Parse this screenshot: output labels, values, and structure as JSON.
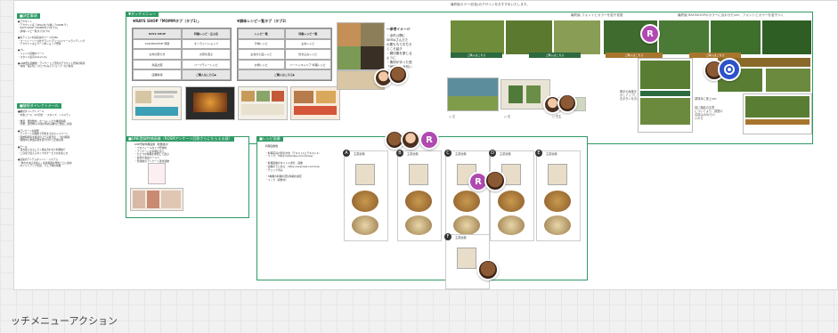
{
  "bottom_label": "ッチメニューアクション",
  "top_note": "最終版カラー(紅色)のデザインをおすすめいたします。",
  "section_tags": {
    "left_top": "■決定事項",
    "touch_menu": "▼タッチメニュー",
    "left_mid": "■継続ダイレクトメール",
    "line_section": "■LINE登録特典画像（ROSMアンケート回答さらにもらえる部）",
    "recipe_section": "■レシピ画像"
  },
  "tab_labels": {
    "shop_tab": "▼RAYS SHOP「MOMMタブ（タブ1）」",
    "recipe_tab": "▼調味レシピ一覧タブ（タブ2）"
  },
  "table_left": {
    "cells": [
      "RAYS SHOP",
      "特集レシピ・豆ぶ名",
      "SAKURASHOP 特選",
      "オンラインショップ",
      "お米の贈り方",
      "お茶を選ぶ",
      "商品比較",
      "ハーブティーレシピ",
      "店舗情報",
      "ご購入はこちら▶"
    ]
  },
  "table_right": {
    "cells": [
      "レシピ一覧",
      "特集レシピ一覧",
      "汁物レシピ",
      "主食レシピ",
      "主食の小皿レシピ",
      "炊き込みレシピ",
      "お鍋レシピ",
      "ハーハッキャリア 料理レシピ",
      "ご購入はこちら▶"
    ]
  },
  "callout": {
    "title": "～参考イメージ",
    "lines": [
      "・全件公開に",
      "SEMAさんだた",
      "の要ももでおちろ",
      "ところ紹介",
      "・親切素を繁じる",
      "ように",
      "・素材が手った型",
      "「地球」と合句い",
      "ドアの鮮の_」"
    ]
  },
  "rich_menu_titles": [
    "最終版 フォントとカラーを若干変更",
    "最終版 RAYSSHOPのカラーに合わせたver、フォントとカラーを若干少く"
  ],
  "side_notes": [
    "微手の画像を\nかしアップして、\n右ボタンをおかしく",
    "調味米に差上ver.",
    "前に機能の名表\nについてより、調整の\n名前は/Alから少\nいから"
  ],
  "buy_label": "ご購入はこちら",
  "caption_items": [
    "□ 左",
    "□ 右",
    "□ 先生"
  ],
  "recipe_card_title": "主菜画像",
  "recipe_letters": [
    "A",
    "B",
    "C",
    "D",
    "E",
    "F"
  ],
  "left_text": {
    "intro": "●アカウント\n・アカウント名「SEGaタブ2種」「COMM チ」\n・RAYS SHOP「MOMMタブ(タブ1)」\n・調味レシピ一覧タブ(タブ2)\n\n●各アイコンの接続先のページのURL\n・フードトーリー以外グランド(アイコン)ページ/ランディング\n・アカウントなどページ用ショップ登録\n\n●ブレ\n・ジャンル画像のページ\n・スタイル表示(1st-2) (A)\n\n●LINE配信画像数・アンケートご回答のアカウント登録の取得\n・特典「電子化」(ひとつ)(みそ)ショップ  なた取得",
    "mid": "■継続ダイレクトメール\n・対象コース：6カ月分  ・スタンプ、ノベルティ\n\n・数量：発送数約 - ホームレシピの継続特典\n・手順：送付物(その後の利用実績など発生し次第)\n\n●アンケートの概要\n・アンケート自動的で回答するのキャンペーン\n・開始時期等を確認の上で実施予定  ・受付期間\n・期間中に参加応募を受け付けて定期公開\n\n●テーマ\n・漢方薬とおもしろく組み合わせた料理紹介\n・ご自宅で使えるタイプのサービスのお知らせ\n\n●追加のアイテムポイント・システム\n・「体力のある家族に」提案料理を季節ごとに案内\n・ポイントアップ企画、フェア時の特典"
  },
  "line_text": "LINE登録特典画像（総量検討）\n・プロフィールタイプ登録中\n・アンケートの手順を追う\n・ひとつの特典を参照して選ぶ\n・最新の会員ページへ\n・登録後のアンケート受付開始",
  "recipe_text": "料理画像数\n\n・料理写真の配信方法（テキスト1とテキスト2）\n・リンク：https://example.com/recipe/\n\n・料理画像のタイトル部分 - 画像\n・画像の下にある：https://example.com/line/\n・チェック済み\n\n・3種類の料理の配信時期の確定\n・リンク（調整中）"
}
